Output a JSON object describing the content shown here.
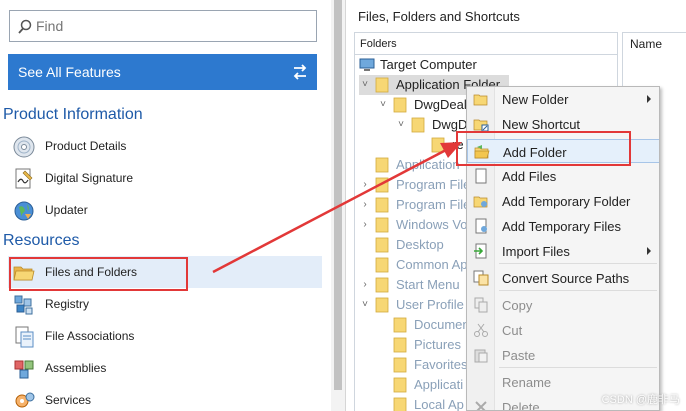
{
  "left": {
    "search": {
      "placeholder": "Find"
    },
    "features_button": "See All Features",
    "sections": [
      {
        "title": "Product Information",
        "items": [
          {
            "label": "Product Details",
            "icon": "cd-icon"
          },
          {
            "label": "Digital Signature",
            "icon": "signature-icon"
          },
          {
            "label": "Updater",
            "icon": "globe-icon"
          }
        ]
      },
      {
        "title": "Resources",
        "items": [
          {
            "label": "Files and Folders",
            "icon": "folder-icon",
            "selected": true
          },
          {
            "label": "Registry",
            "icon": "registry-icon"
          },
          {
            "label": "File Associations",
            "icon": "file-association-icon"
          },
          {
            "label": "Assemblies",
            "icon": "assemblies-icon"
          },
          {
            "label": "Services",
            "icon": "services-icon"
          }
        ]
      }
    ]
  },
  "right": {
    "title": "Files, Folders and Shortcuts",
    "folders_header": "Folders",
    "name_header": "Name",
    "tree": [
      {
        "label": "Target Computer",
        "icon": "computer-icon",
        "expander": ""
      },
      {
        "label": "Application Folder",
        "expander": "collapse",
        "selected": true
      },
      {
        "label": "DwgDeal",
        "expander": "collapse"
      },
      {
        "label": "DwgD",
        "expander": "collapse"
      },
      {
        "label": "re",
        "expander": ""
      },
      {
        "label": "Application",
        "expander": "",
        "dim": true
      },
      {
        "label": "Program File",
        "expander": "expand",
        "dim": true
      },
      {
        "label": "Program File",
        "expander": "expand",
        "dim": true
      },
      {
        "label": "Windows Vo",
        "expander": "expand",
        "dim": true
      },
      {
        "label": "Desktop",
        "expander": "",
        "dim": true
      },
      {
        "label": "Common Ap",
        "expander": "",
        "dim": true
      },
      {
        "label": "Start Menu",
        "expander": "expand",
        "dim": true
      },
      {
        "label": "User Profile",
        "expander": "collapse",
        "dim": true
      },
      {
        "label": "Documen",
        "expander": "",
        "dim": true
      },
      {
        "label": "Pictures",
        "expander": "",
        "dim": true
      },
      {
        "label": "Favorites",
        "expander": "",
        "dim": true
      },
      {
        "label": "Applicati",
        "expander": "",
        "dim": true
      },
      {
        "label": "Local Ap",
        "expander": "",
        "dim": true
      }
    ]
  },
  "context_menu": {
    "items": [
      {
        "label": "New Folder",
        "icon": "new-folder-icon",
        "submenu": true
      },
      {
        "label": "New Shortcut",
        "icon": "shortcut-icon"
      },
      {
        "label": "Add Folder",
        "icon": "add-folder-icon",
        "highlighted": true
      },
      {
        "label": "Add Files",
        "icon": "add-files-icon"
      },
      {
        "label": "Add Temporary Folder",
        "icon": "temp-folder-icon"
      },
      {
        "label": "Add Temporary Files",
        "icon": "temp-files-icon"
      },
      {
        "label": "Import Files",
        "icon": "import-icon",
        "submenu": true
      },
      {
        "label": "Convert Source Paths",
        "icon": "convert-icon"
      },
      {
        "label": "Copy",
        "icon": "copy-icon",
        "disabled": true
      },
      {
        "label": "Cut",
        "icon": "cut-icon",
        "disabled": true
      },
      {
        "label": "Paste",
        "icon": "paste-icon",
        "disabled": true
      },
      {
        "label": "Rename",
        "icon": "",
        "disabled": true
      },
      {
        "label": "Delete",
        "icon": "delete-icon",
        "disabled": true
      }
    ]
  },
  "watermark": "CSDN @鹿非马",
  "colors": {
    "accent": "#2d79cf",
    "section_title": "#1e5aa8",
    "annotation_red": "#e23838",
    "folder": "#f7d774"
  }
}
